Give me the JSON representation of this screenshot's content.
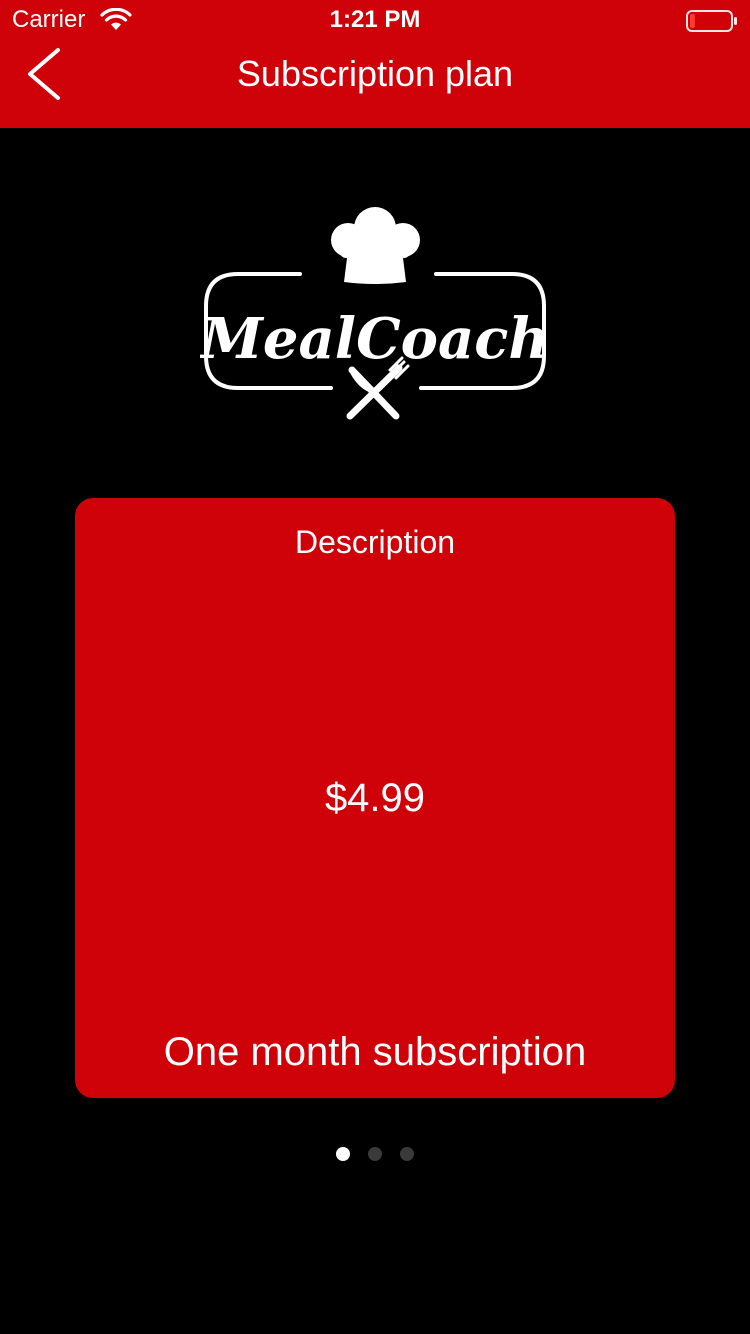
{
  "status_bar": {
    "carrier": "Carrier",
    "time": "1:21 PM",
    "battery_level_percent": 10,
    "battery_color": "#ff3b30"
  },
  "nav": {
    "title": "Subscription plan",
    "back_icon": "chevron-left-icon"
  },
  "logo": {
    "text": "MealCoach",
    "icons": [
      "chef-hat-icon",
      "fork-knife-icon"
    ]
  },
  "plan_card": {
    "description": "Description",
    "price": "$4.99",
    "plan_name": "One month subscription"
  },
  "pager": {
    "page_count": 3,
    "active_index": 0
  },
  "colors": {
    "brand_red": "#cf0209",
    "background": "#000000",
    "text": "#ffffff",
    "inactive_dot": "#3a3a3a"
  }
}
